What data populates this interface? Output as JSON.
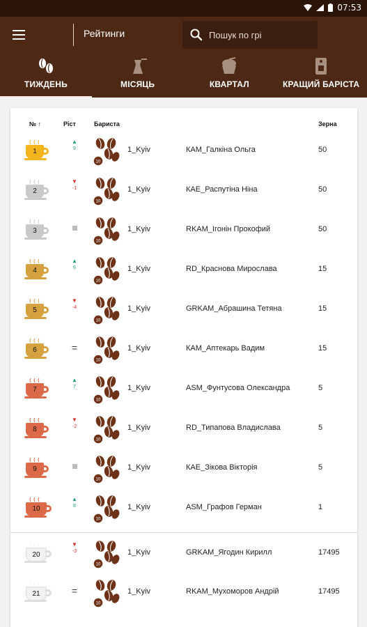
{
  "status_bar": {
    "time": "07:53"
  },
  "app_bar": {
    "title": "Рейтинги",
    "search_placeholder": "Пошук по грі"
  },
  "tabs": [
    {
      "label": "ТИЖДЕНЬ",
      "icon": "coffee-beans-icon",
      "active": true
    },
    {
      "label": "МІСЯЦЬ",
      "icon": "cezve-icon",
      "active": false
    },
    {
      "label": "КВАРТАЛ",
      "icon": "coffee-grinder-icon",
      "active": false
    },
    {
      "label": "КРАЩИЙ БАРІСТА",
      "icon": "coffee-machine-icon",
      "active": false
    }
  ],
  "table": {
    "headers": {
      "rank": "№ ↑",
      "growth": "Ріст",
      "barista": "Бариста",
      "beans": "Зерна"
    },
    "rows": [
      {
        "rank": "1",
        "tier": "gold",
        "trend": "up",
        "change": "9",
        "region": "1_Kyiv",
        "name": "КАМ_Галкіна Ольга",
        "beans": "50"
      },
      {
        "rank": "2",
        "tier": "silver",
        "trend": "down",
        "change": "-1",
        "region": "1_Kyiv",
        "name": "КАЕ_Распутіна Ніна",
        "beans": "50"
      },
      {
        "rank": "3",
        "tier": "silver",
        "trend": "same",
        "change": "",
        "region": "1_Kyiv",
        "name": "RKAM_Ігонін Прокофий",
        "beans": "50"
      },
      {
        "rank": "4",
        "tier": "bronze",
        "trend": "up",
        "change": "6",
        "region": "1_Kyiv",
        "name": "RD_Краснова Мирослава",
        "beans": "15"
      },
      {
        "rank": "5",
        "tier": "bronze",
        "trend": "down",
        "change": "-4",
        "region": "1_Kyiv",
        "name": "GRKAM_Абрашина Тетяна",
        "beans": "15"
      },
      {
        "rank": "6",
        "tier": "bronze",
        "trend": "equal",
        "change": "=",
        "region": "1_Kyiv",
        "name": "КАМ_Аптекарь Вадим",
        "beans": "15"
      },
      {
        "rank": "7",
        "tier": "red",
        "trend": "up",
        "change": "7",
        "region": "1_Kyiv",
        "name": "ASM_Фунтусова Олександра",
        "beans": "5"
      },
      {
        "rank": "8",
        "tier": "red",
        "trend": "down",
        "change": "-2",
        "region": "1_Kyiv",
        "name": "RD_Типапова Владислава",
        "beans": "5"
      },
      {
        "rank": "9",
        "tier": "red",
        "trend": "same",
        "change": "",
        "region": "1_Kyiv",
        "name": "КАЕ_Зікова Вікторія",
        "beans": "5"
      },
      {
        "rank": "10",
        "tier": "red",
        "trend": "up",
        "change": "8",
        "region": "1_Kyiv",
        "name": "ASM_Графов Герман",
        "beans": "1"
      },
      {
        "rank": "20",
        "tier": "white",
        "trend": "down",
        "change": "-3",
        "region": "1_Kyiv",
        "name": "GRKAM_Ягодин Кирилл",
        "beans": "17495"
      },
      {
        "rank": "21",
        "tier": "white",
        "trend": "equal",
        "change": "=",
        "region": "1_Kyiv",
        "name": "RKAM_Мухоморов Андрій",
        "beans": "17495"
      }
    ]
  },
  "colors": {
    "app_bar": "#4d2814",
    "status_bar": "#2b1509",
    "gold": "#f3b51b",
    "silver": "#c9c9c9",
    "bronze": "#d5a23f",
    "red": "#dc6a48",
    "white": "#f2f2f2",
    "up": "#1c9a7a",
    "down": "#d32b2b",
    "bean": "#6e3216"
  }
}
